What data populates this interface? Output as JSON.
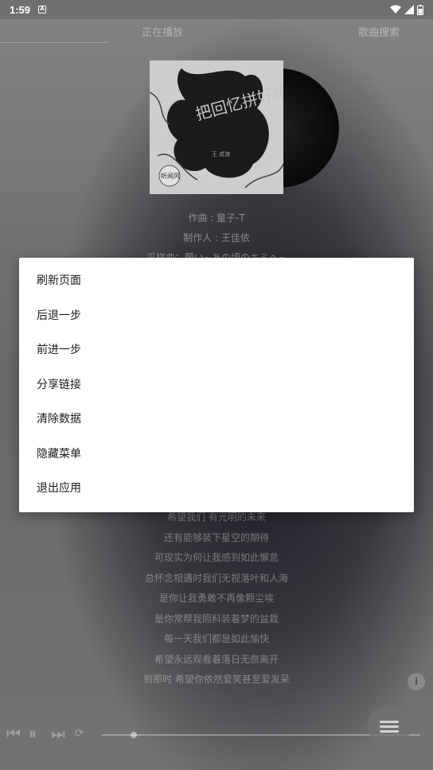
{
  "status_bar": {
    "time": "1:59",
    "notif_glyph": "A"
  },
  "tabs": [
    "",
    "正在播放",
    "",
    "歌曲搜索"
  ],
  "credits": [
    "作曲 : 童子-T",
    "制作人 : 王佳依",
    "采样曲：願い~あの頃のキミへ~"
  ],
  "lyrics": [
    "希望我们 有光明的未来",
    "还有能够装下星空的期待",
    "可现实为何让我感到如此懈怠",
    "总怀念相遇时我们无视落叶和人海",
    "是你让我勇敢不再像颗尘埃",
    "是你常帮我照料装着梦的盆栽",
    "每一天我们都是如此愉快",
    "希望永远观看着落日无奈离开",
    "到那时 希望你依然爱笑甚至爱发呆"
  ],
  "cover": {
    "title_text": "把回忆拼好给你",
    "artist": "王 贰浪",
    "badge": "听闻风"
  },
  "player": {
    "progress_fraction": 0.1
  },
  "menu": {
    "items": [
      "刷新页面",
      "后退一步",
      "前进一步",
      "分享链接",
      "清除数据",
      "隐藏菜单",
      "退出应用"
    ]
  },
  "icons": {
    "wifi": "wifi-icon",
    "signal": "signal-icon",
    "battery": "battery-icon",
    "prev": "skip-previous-icon",
    "pause": "pause-icon",
    "next": "skip-next-icon",
    "menu": "hamburger-menu-icon",
    "info": "info-icon"
  }
}
